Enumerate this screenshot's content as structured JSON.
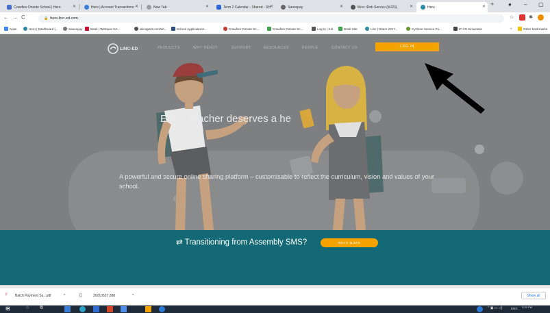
{
  "browser": {
    "tabs": [
      {
        "label": "Crawfies Onsote School | Hero",
        "color": "#4a6ecf"
      },
      {
        "label": "Hero | Account Transactions",
        "color": "#3c7ddc"
      },
      {
        "label": "New Tab",
        "color": "#888888"
      },
      {
        "label": "Term 2 Calendar - Shared - SH",
        "color": "#2b65d9"
      },
      {
        "label": "Saucepay",
        "color": "#666666"
      },
      {
        "label": "Moo: iDeb Service (MJ2S)",
        "color": "#555555"
      },
      {
        "label": "Hero",
        "color": "#2c8aa6"
      }
    ],
    "new_tab": "+",
    "url": "hero.linc-ed.com",
    "bookmarks": [
      {
        "label": "Apps",
        "color": "#4285f4"
      },
      {
        "label": "Hero | Dashboard |...",
        "color": "#2c8aa6"
      },
      {
        "label": "Saucepay",
        "color": "#777777"
      },
      {
        "label": "Bank | Westpac NA...",
        "color": "#c8102e"
      },
      {
        "label": "abcagent.com/Wi...",
        "color": "#555555"
      },
      {
        "label": "School Applications...",
        "color": "#2b4c7e"
      },
      {
        "label": "Crawfies Onsote Sc...",
        "color": "#c0392b"
      },
      {
        "label": "Crawfies Onsote Sc...",
        "color": "#3fa34d"
      },
      {
        "label": "Log In | Kiri",
        "color": "#555555"
      },
      {
        "label": "Desk Site",
        "color": "#3fa34d"
      },
      {
        "label": "Linc | Ditum 2017...",
        "color": "#2c8aa6"
      },
      {
        "label": "Cyclone Service Po...",
        "color": "#6c9b2f"
      },
      {
        "label": "IP CS Kiriwetara",
        "color": "#444444"
      }
    ],
    "other_bookmarks": "Other bookmarks"
  },
  "site": {
    "logo_text": "LINC-ED",
    "nav": [
      "PRODUCTS",
      "WHY HERO?",
      "SUPPORT",
      "RESOURCES",
      "PEOPLE",
      "CONTACT US"
    ],
    "login_label": "LOG IN",
    "headline": "Every teacher deserves a he",
    "subheadline": "A powerful and secure online sharing platform – customisable to reflect the curriculum, vision and values of your school.",
    "banner_text": "Transitioning from Assembly SMS?",
    "read_more": "READ MORE",
    "colors": {
      "accent": "#f5a300",
      "teal": "#136a76",
      "overlay": "#7e7f80"
    }
  },
  "downloads": {
    "items": [
      {
        "label": "Batch Payment Su...pdf",
        "icon": "pdf-icon"
      },
      {
        "label": "20210527.288",
        "icon": "file-icon"
      }
    ],
    "show_all": "Show all"
  },
  "taskbar": {
    "time": "3:29 PM",
    "lang": "ENG"
  }
}
